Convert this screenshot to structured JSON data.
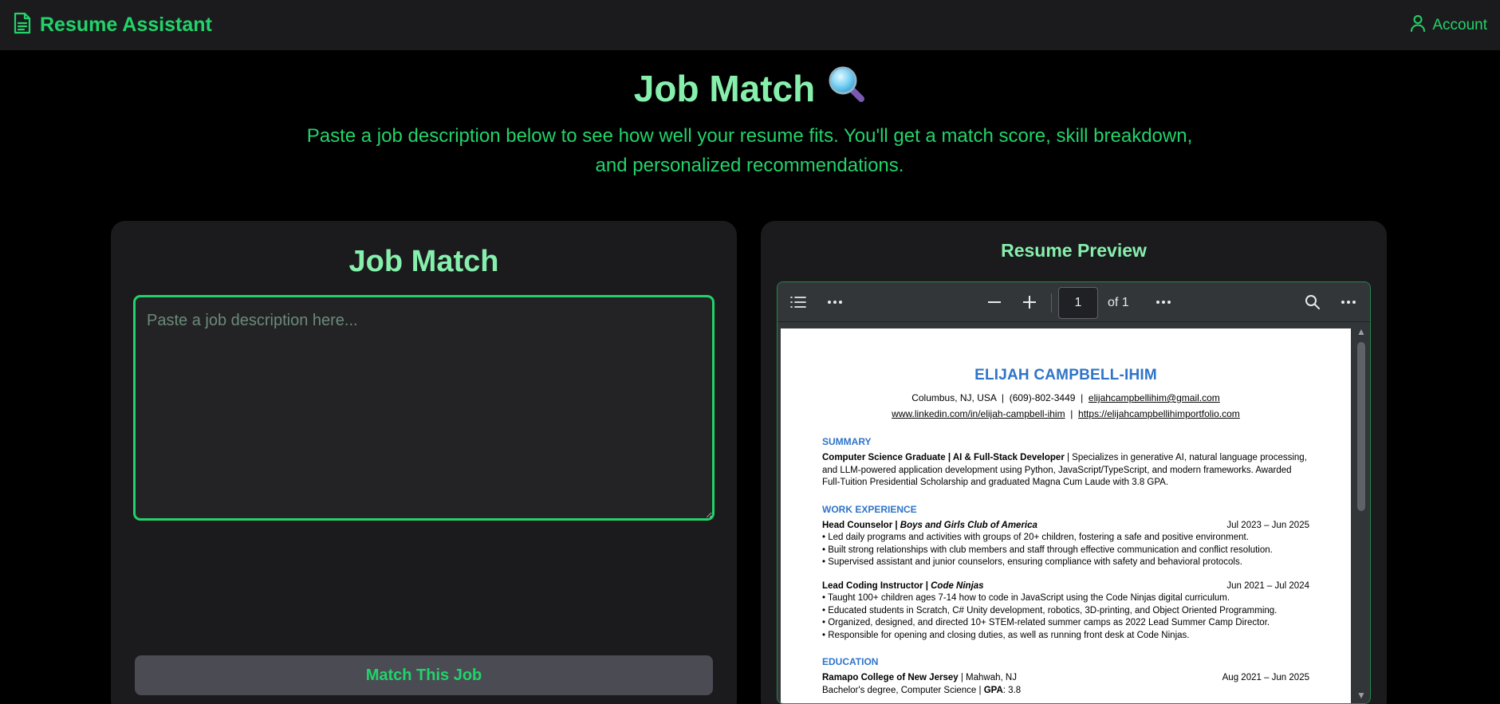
{
  "app": {
    "brand_name": "Resume Assistant",
    "account_label": "Account",
    "accent_color": "#22d36a",
    "title_color": "#86efac"
  },
  "hero": {
    "title": "Job Match",
    "title_icon": "magnifier-emoji",
    "subtitle": "Paste a job description below to see how well your resume fits. You'll get a match score, skill breakdown, and personalized recommendations."
  },
  "job_match": {
    "title": "Job Match",
    "textarea_placeholder": "Paste a job description here...",
    "textarea_value": "",
    "button_label": "Match This Job"
  },
  "preview": {
    "title": "Resume Preview",
    "toolbar": {
      "page_number": "1",
      "page_of": "of 1"
    },
    "resume": {
      "name": "ELIJAH CAMPBELL-IHIM",
      "location": "Columbus, NJ, USA",
      "phone": "(609)-802-3449",
      "email": "elijahcampbellihim@gmail.com",
      "linkedin": "www.linkedin.com/in/elijah-campbell-ihim",
      "portfolio": "https://elijahcampbellihimportfolio.com",
      "summary_heading": "SUMMARY",
      "summary_bold": "Computer Science Graduate | AI & Full-Stack Developer",
      "summary_text": " | Specializes in generative AI, natural language processing, and LLM-powered application development using Python, JavaScript/TypeScript, and modern frameworks. Awarded Full-Tuition Presidential Scholarship and graduated Magna Cum Laude with 3.8 GPA.",
      "work_heading": "WORK EXPERIENCE",
      "jobs": [
        {
          "title": "Head Counselor | ",
          "org": "Boys and Girls Club of America",
          "dates": "Jul 2023 – Jun 2025",
          "bullets": [
            "• Led daily programs and activities with groups of 20+ children, fostering a safe and positive environment.",
            "• Built strong relationships with club members and staff through effective communication and conflict resolution.",
            "• Supervised assistant and junior counselors, ensuring compliance with safety and behavioral protocols."
          ]
        },
        {
          "title": "Lead Coding Instructor | ",
          "org": "Code Ninjas",
          "dates": "Jun 2021 – Jul 2024",
          "bullets": [
            "• Taught 100+ children ages 7-14 how to code in JavaScript using the Code Ninjas digital curriculum.",
            "• Educated students in Scratch, C# Unity development, robotics, 3D-printing, and Object Oriented Programming.",
            "• Organized, designed, and directed 10+ STEM-related summer camps as 2022 Lead Summer Camp Director.",
            "• Responsible for opening and closing duties, as well as running front desk at Code Ninjas."
          ]
        }
      ],
      "education_heading": "EDUCATION",
      "school": "Ramapo College of New Jersey",
      "school_location": " | Mahwah, NJ",
      "school_dates": "Aug 2021 – Jun 2025",
      "degree": "Bachelor's degree, Computer Science | ",
      "gpa_label": "GPA",
      "gpa_value": ": 3.8"
    }
  }
}
